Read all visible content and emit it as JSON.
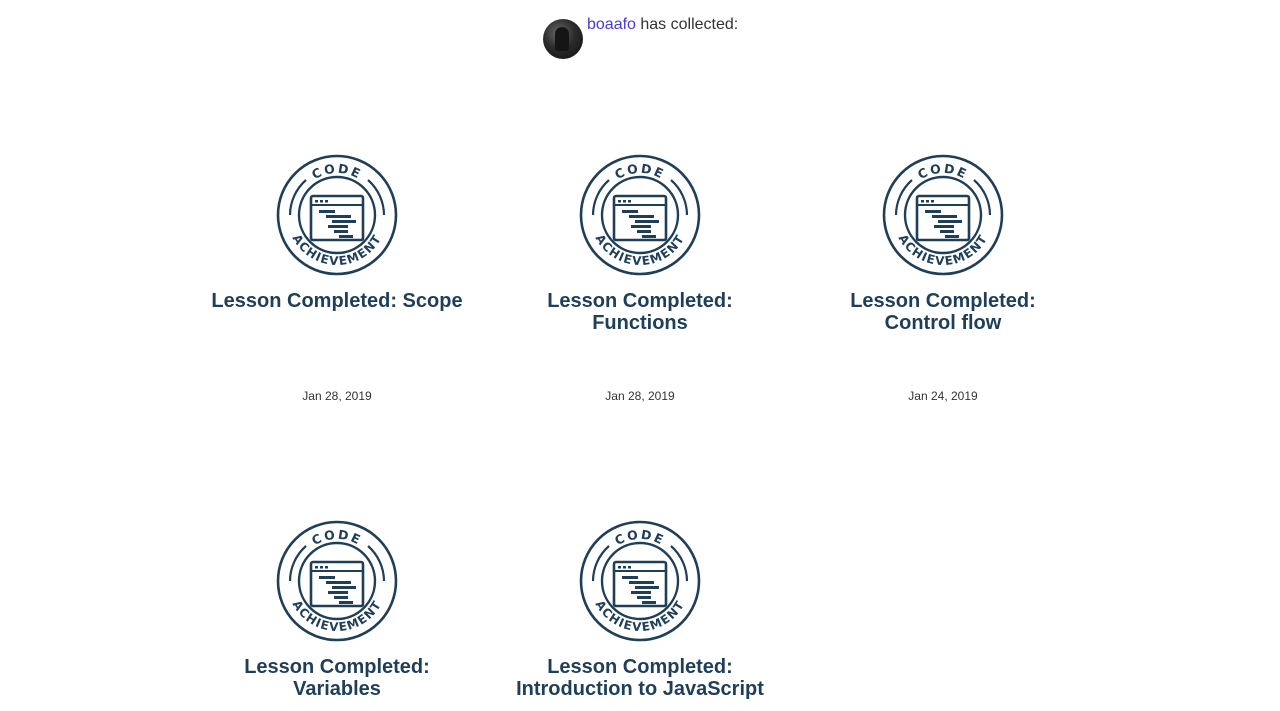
{
  "header": {
    "username": "boaafo",
    "suffix": " has collected:"
  },
  "badge_text": {
    "top": "CODE",
    "bottom": "ACHIEVEMENT"
  },
  "colors": {
    "badge": "#1f3e57",
    "link": "#4a3ad6"
  },
  "achievements": [
    {
      "title": "Lesson Completed: Scope",
      "date": "Jan 28, 2019"
    },
    {
      "title": "Lesson Completed: Functions",
      "date": "Jan 28, 2019"
    },
    {
      "title": "Lesson Completed: Control flow",
      "date": "Jan 24, 2019"
    },
    {
      "title": "Lesson Completed: Variables",
      "date": ""
    },
    {
      "title": "Lesson Completed: Introduction to JavaScript",
      "date": ""
    }
  ]
}
